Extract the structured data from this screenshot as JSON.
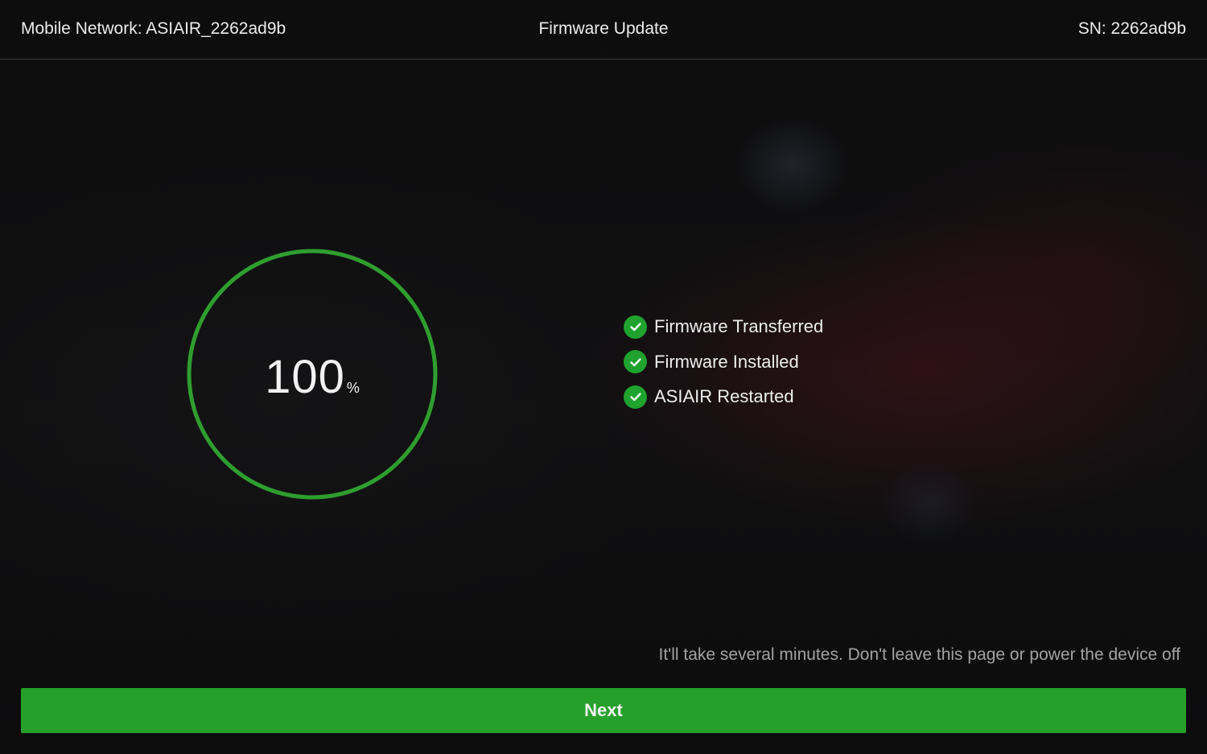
{
  "header": {
    "network_label": "Mobile Network: ASIAIR_2262ad9b",
    "title": "Firmware Update",
    "serial_label": "SN: 2262ad9b"
  },
  "progress": {
    "value": "100",
    "unit": "%",
    "fraction": 1.0,
    "ring_color": "#2f9e2f"
  },
  "steps": [
    {
      "label": "Firmware Transferred",
      "status": "done",
      "icon": "check-circle-icon"
    },
    {
      "label": "Firmware Installed",
      "status": "done",
      "icon": "check-circle-icon"
    },
    {
      "label": "ASIAIR Restarted",
      "status": "done",
      "icon": "check-circle-icon"
    }
  ],
  "notice": "It'll take several minutes. Don't leave this page or power the device off",
  "actions": {
    "next_label": "Next"
  },
  "colors": {
    "accent_green": "#25a02a",
    "background": "#0c0c0d"
  }
}
